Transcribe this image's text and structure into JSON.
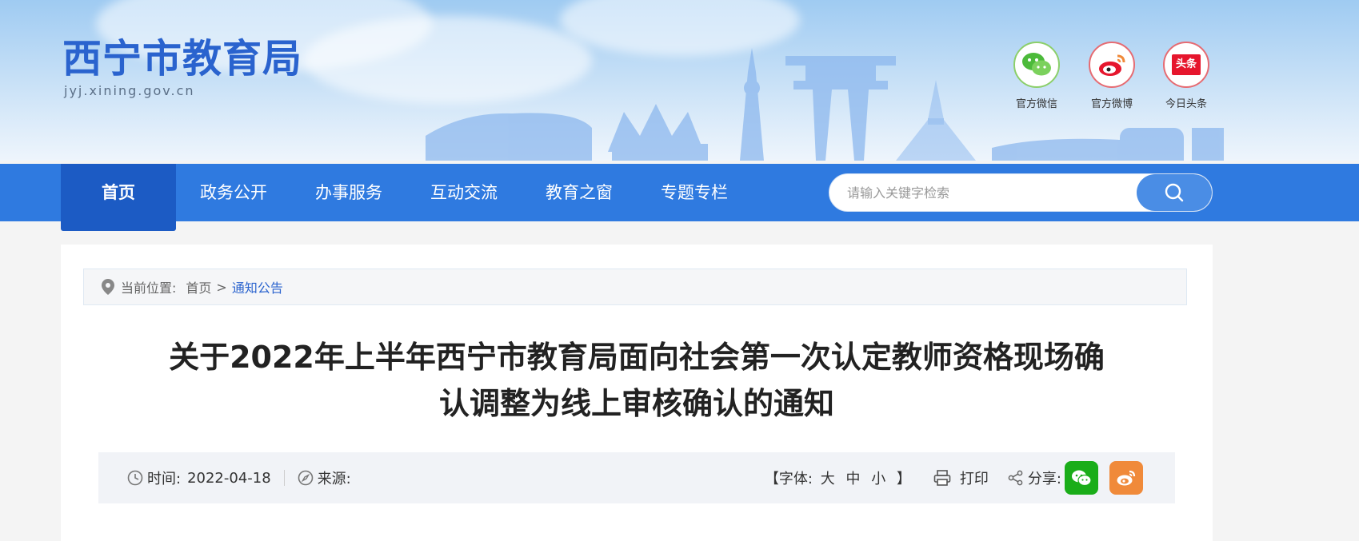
{
  "site": {
    "title": "西宁市教育局",
    "domain": "jyj.xining.gov.cn"
  },
  "social": [
    {
      "label": "官方微信",
      "icon": "wechat-icon",
      "color": "#3fb14c"
    },
    {
      "label": "官方微博",
      "icon": "weibo-icon",
      "color": "#e6162d"
    },
    {
      "label": "今日头条",
      "icon": "toutiao-icon",
      "color": "#e6162d",
      "badge": "头条"
    }
  ],
  "nav": {
    "items": [
      {
        "label": "首页",
        "active": true
      },
      {
        "label": "政务公开"
      },
      {
        "label": "办事服务"
      },
      {
        "label": "互动交流"
      },
      {
        "label": "教育之窗"
      },
      {
        "label": "专题专栏"
      }
    ],
    "search_placeholder": "请输入关键字检索"
  },
  "breadcrumb": {
    "prefix": "当前位置:",
    "home": "首页",
    "separator": ">",
    "current": "通知公告"
  },
  "article": {
    "title_line1": "关于2022年上半年西宁市教育局面向社会第一次认定教师资格现场确",
    "title_line2": "认调整为线上审核确认的通知",
    "time_label": "时间:",
    "time_value": "2022-04-18",
    "source_label": "来源:",
    "font_label": "【字体:",
    "font_large": "大",
    "font_medium": "中",
    "font_small": "小",
    "font_close": "】",
    "print_label": "打印",
    "share_label": "分享:"
  },
  "colors": {
    "brand_blue": "#2f7ae0",
    "nav_active": "#1c5bc4",
    "link_blue": "#2a63ce",
    "wechat_green": "#1aad19",
    "weibo_orange": "#f08a3a"
  }
}
